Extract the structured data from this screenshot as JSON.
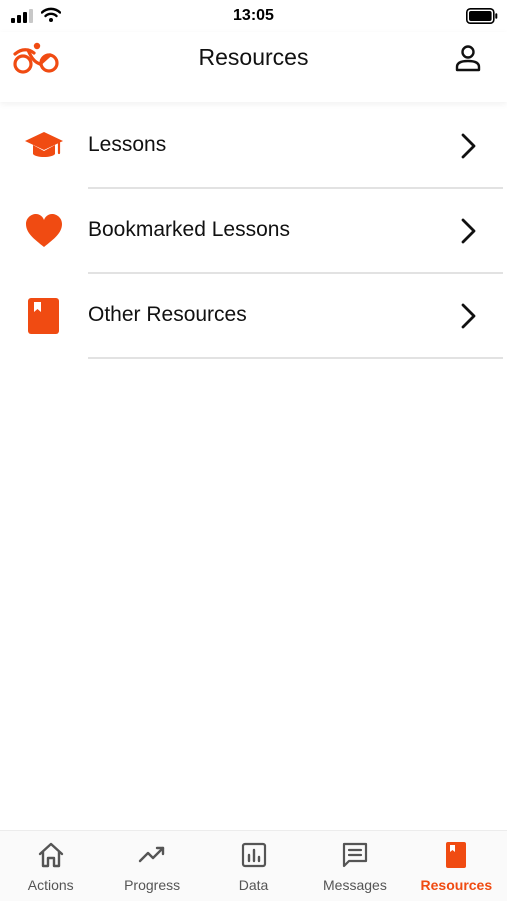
{
  "status_bar": {
    "time": "13:05"
  },
  "header": {
    "title": "Resources"
  },
  "menu": {
    "items": [
      {
        "label": "Lessons",
        "icon": "graduation-cap-icon"
      },
      {
        "label": "Bookmarked Lessons",
        "icon": "heart-icon"
      },
      {
        "label": "Other Resources",
        "icon": "book-icon"
      }
    ]
  },
  "tabs": {
    "items": [
      {
        "label": "Actions",
        "icon": "home-icon"
      },
      {
        "label": "Progress",
        "icon": "trend-icon"
      },
      {
        "label": "Data",
        "icon": "chart-icon"
      },
      {
        "label": "Messages",
        "icon": "message-icon"
      },
      {
        "label": "Resources",
        "icon": "book-icon",
        "active": true
      }
    ]
  },
  "colors": {
    "accent": "#f04b12",
    "text": "#111111",
    "tab_inactive": "#555555",
    "divider": "#e2e2e2"
  }
}
